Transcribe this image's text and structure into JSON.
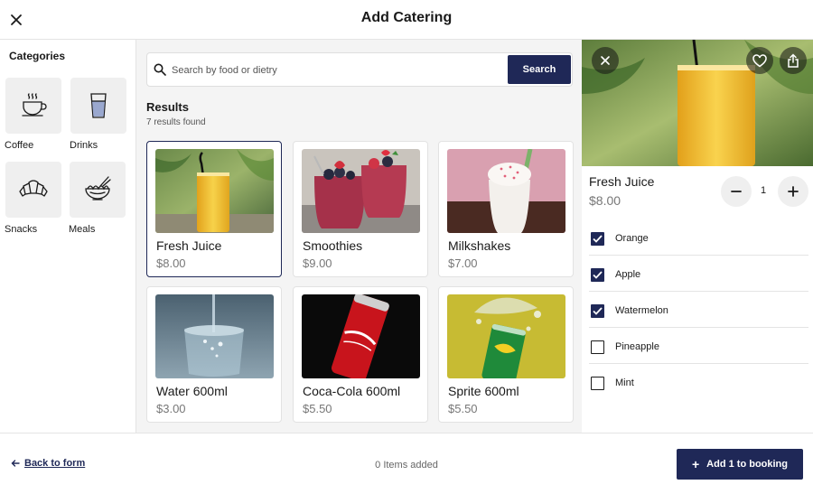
{
  "header": {
    "title": "Add Catering",
    "close_icon": "close-icon"
  },
  "sidebar": {
    "heading": "Categories",
    "items": [
      {
        "label": "Coffee",
        "icon": "coffee-cup-icon"
      },
      {
        "label": "Drinks",
        "icon": "glass-icon"
      },
      {
        "label": "Snacks",
        "icon": "croissant-icon"
      },
      {
        "label": "Meals",
        "icon": "noodle-bowl-icon"
      }
    ]
  },
  "search": {
    "placeholder": "Search by food or dietry",
    "value": "",
    "button_label": "Search"
  },
  "results": {
    "title": "Results",
    "count": "7 results found",
    "items": [
      {
        "name": "Fresh Juice",
        "price": "$8.00",
        "selected": true
      },
      {
        "name": "Smoothies",
        "price": "$9.00"
      },
      {
        "name": "Milkshakes",
        "price": "$7.00"
      },
      {
        "name": "Water 600ml",
        "price": "$3.00"
      },
      {
        "name": "Coca-Cola 600ml",
        "price": "$5.50"
      },
      {
        "name": "Sprite 600ml",
        "price": "$5.50"
      }
    ]
  },
  "detail": {
    "name": "Fresh Juice",
    "price": "$8.00",
    "quantity": "1",
    "options": [
      {
        "label": "Orange",
        "checked": true
      },
      {
        "label": "Apple",
        "checked": true
      },
      {
        "label": "Watermelon",
        "checked": true
      },
      {
        "label": "Pineapple",
        "checked": false
      },
      {
        "label": "Mint",
        "checked": false
      }
    ]
  },
  "footer": {
    "back_label": "Back to form",
    "items_added": "0 Items added",
    "add_label": "Add 1 to booking"
  },
  "colors": {
    "accent": "#1f2857"
  }
}
